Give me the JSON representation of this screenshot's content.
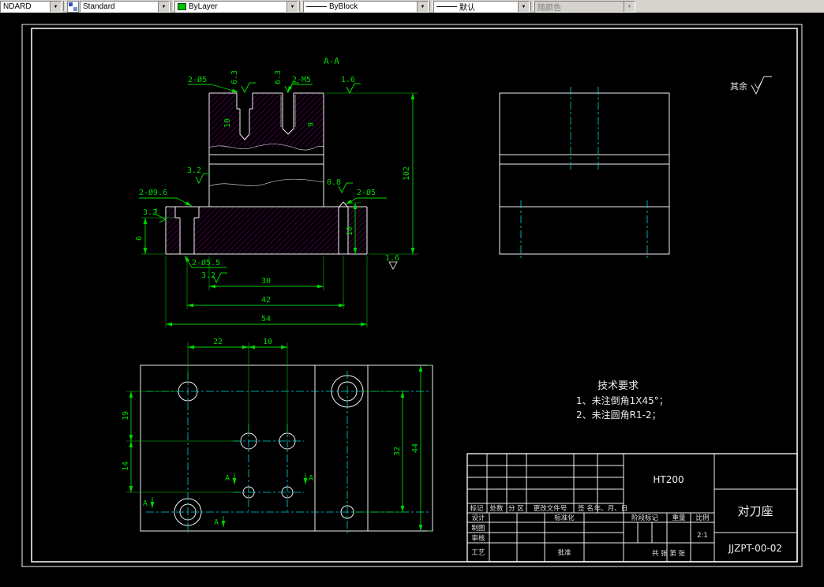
{
  "toolbar": {
    "style_value": "NDARD",
    "text_style_value": "Standard",
    "color_value": "ByLayer",
    "linetype_value": "ByBlock",
    "lineweight_value": "默认",
    "plot_style_value": "随颜色"
  },
  "drawing": {
    "section_label": "A-A",
    "surface_note_label": "其余",
    "tech_req": {
      "title": "技术要求",
      "item1": "1、未注倒角1X45°；",
      "item2": "2、未注圆角R1-2；"
    },
    "labels": {
      "hole_top_left": "2-Ø5",
      "hole_top_right": "2-M5",
      "hole_left": "2-Ø9.6",
      "hole_right": "2-Ø5",
      "hole_bottom": "2-Ø5.5"
    },
    "dims": {
      "height": "102",
      "w30": "30",
      "w42": "42",
      "w54": "54",
      "depth6": "6",
      "depth10": "10",
      "cbore_depth": "10",
      "thread_depth": "9",
      "p22": "22",
      "p10": "10",
      "p19": "19",
      "p14": "14",
      "p32": "32",
      "p44": "44"
    },
    "roughness": {
      "top_left": "6.3",
      "top_right2": "6.3",
      "r16_top": "1.6",
      "r32_mid": "3.2",
      "r32_left": "3.2",
      "r08_right": "0.8",
      "r32_bottom": "3.2",
      "r16_bottom": "1.6"
    },
    "section_arrow": "A"
  },
  "titleblock": {
    "material": "HT200",
    "part_name": "对刀座",
    "drawing_number": "JJZPT-00-02",
    "scale_value": "2:1",
    "headers": {
      "mark": "标记",
      "count": "处数",
      "zone": "分 区",
      "change_file": "更改文件号",
      "signature": "签 名",
      "date": "年、月、日"
    },
    "roles": {
      "design": "设计",
      "draft": "制图",
      "check": "审核",
      "process": "工艺",
      "standardize": "标准化",
      "approve": "批准"
    },
    "fields": {
      "stage_mark": "阶段标记",
      "weight": "重量",
      "scale": "比例",
      "sheets": "共 张 第 张"
    }
  }
}
